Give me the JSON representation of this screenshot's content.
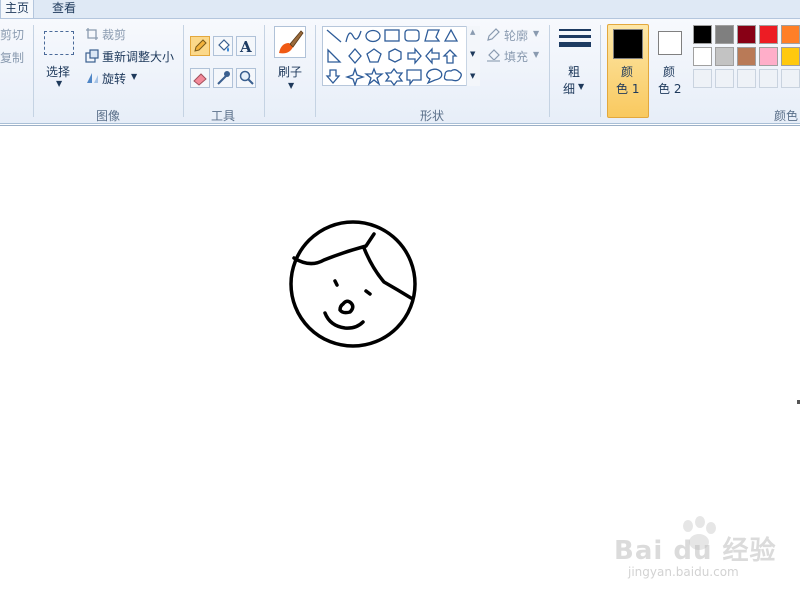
{
  "tabs": {
    "home": "主页",
    "view": "查看"
  },
  "clipboard": {
    "cut": "剪切",
    "copy": "复制"
  },
  "image": {
    "select": "选择",
    "crop": "裁剪",
    "resize": "重新调整大小",
    "rotate": "旋转",
    "label": "图像"
  },
  "tools": {
    "label": "工具",
    "items": [
      "pencil-icon",
      "fill-icon",
      "text-icon",
      "eraser-icon",
      "color-picker-icon",
      "magnifier-icon"
    ],
    "active": "pencil-icon"
  },
  "brushes": {
    "label": "刷子"
  },
  "shapes": {
    "label": "形状",
    "outline": "轮廓",
    "fill": "填充"
  },
  "size": {
    "label_top": "粗",
    "label_bottom": "细"
  },
  "colors": {
    "label": "颜色",
    "color1_top": "颜",
    "color1_bottom": "色 1",
    "color2_top": "颜",
    "color2_bottom": "色 2",
    "color1_value": "#000000",
    "color2_value": "#ffffff",
    "palette_row1": [
      "#000000",
      "#7f7f7f",
      "#880015",
      "#ed1c24",
      "#ff7f27"
    ],
    "palette_row2": [
      "#ffffff",
      "#c3c3c3",
      "#b97a57",
      "#ffaec9",
      "#ffc90e"
    ]
  },
  "watermark": {
    "brand": "Bai du 经验",
    "url": "jingyan.baidu.com"
  }
}
